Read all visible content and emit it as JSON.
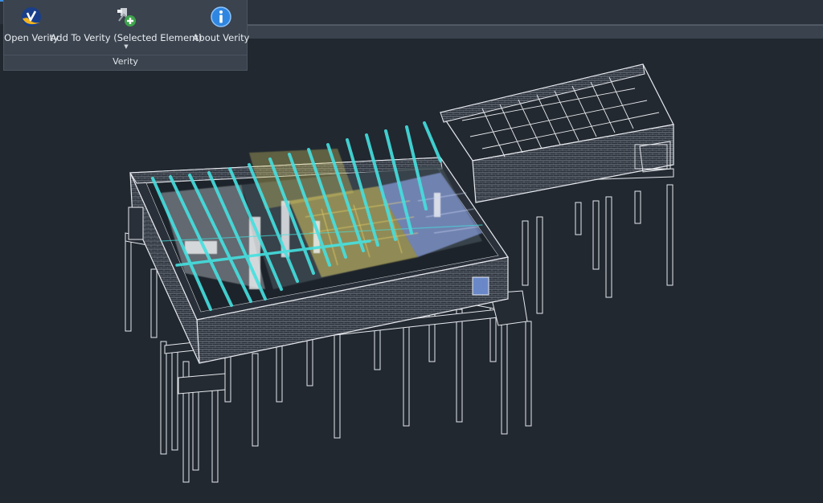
{
  "ribbon": {
    "panel_title": "Verity",
    "buttons": {
      "open": {
        "label": "Open Verity",
        "icon": "verity-logo-icon"
      },
      "add": {
        "label": "Add To Verity (Selected Element)",
        "icon": "add-element-icon",
        "has_dropdown": true
      },
      "about": {
        "label": "About Verity",
        "icon": "info-icon"
      }
    }
  },
  "colors": {
    "background": "#212830",
    "ribbon": "#3b434e",
    "wireframe": "#e6e9ee",
    "beam": "#45e0e0",
    "pointcloud_yellow": "#d8c860",
    "pointcloud_blue": "#8fa6e6"
  }
}
